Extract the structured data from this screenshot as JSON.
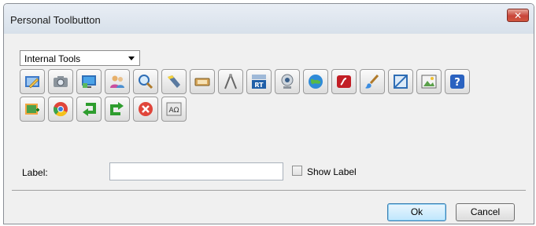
{
  "window": {
    "title": "Personal Toolbutton",
    "close_label": "✕"
  },
  "dropdown": {
    "selected": "Internal Tools"
  },
  "tools_row1": [
    {
      "name": "edit-tool-icon"
    },
    {
      "name": "camera-tool-icon"
    },
    {
      "name": "desktop-tool-icon"
    },
    {
      "name": "users-tool-icon"
    },
    {
      "name": "magnifier-tool-icon"
    },
    {
      "name": "flashlight-tool-icon"
    },
    {
      "name": "keyboard-tool-icon"
    },
    {
      "name": "compass-tool-icon"
    },
    {
      "name": "rt-tool-icon"
    },
    {
      "name": "webcam-tool-icon"
    },
    {
      "name": "globe-tool-icon"
    },
    {
      "name": "flash-tool-icon"
    },
    {
      "name": "paint-brush-tool-icon"
    },
    {
      "name": "crop-tool-icon"
    },
    {
      "name": "image-tool-icon"
    },
    {
      "name": "help-tool-icon"
    }
  ],
  "tools_row2": [
    {
      "name": "add-image-tool-icon"
    },
    {
      "name": "chrome-tool-icon"
    },
    {
      "name": "undo-tool-icon"
    },
    {
      "name": "redo-tool-icon"
    },
    {
      "name": "close-tool-icon"
    },
    {
      "name": "text-tool-icon",
      "text": "AΩ"
    }
  ],
  "form": {
    "label_text": "Label:",
    "label_value": "",
    "show_label_text": "Show Label",
    "show_label_checked": false
  },
  "buttons": {
    "ok": "Ok",
    "cancel": "Cancel"
  },
  "colors": {
    "title_bar": "#dfe6ef",
    "close": "#c9453a",
    "dialog_bg": "#f0f0f0"
  }
}
